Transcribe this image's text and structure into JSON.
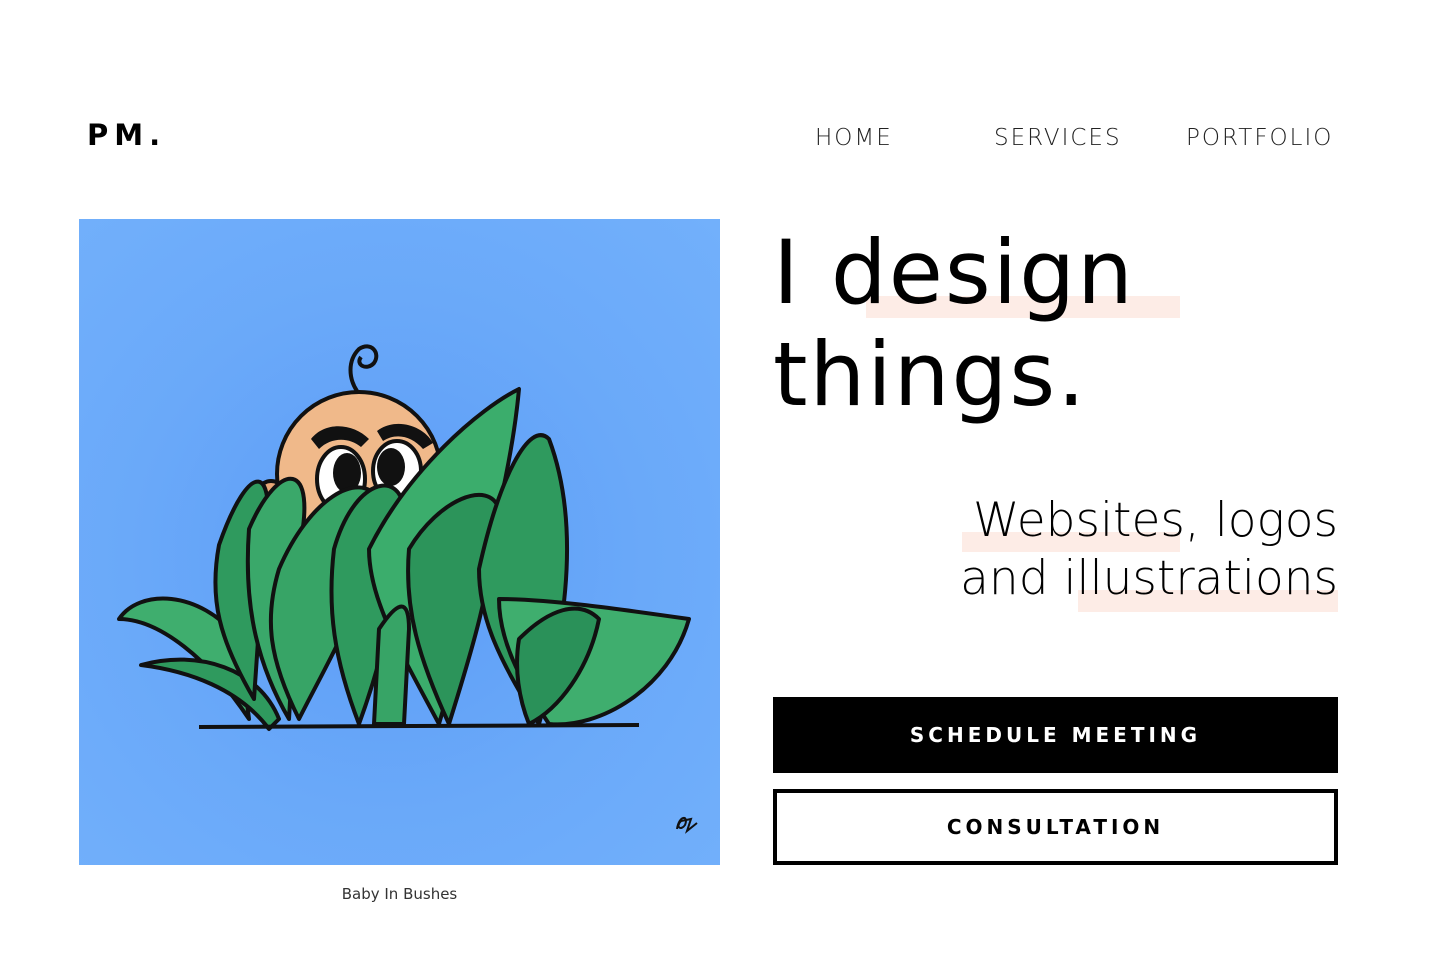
{
  "brand": {
    "logo": "PM."
  },
  "nav": {
    "items": [
      "HOME",
      "SERVICES",
      "PORTFOLIO"
    ]
  },
  "hero": {
    "headline_line1": "I design",
    "headline_line2": "things.",
    "sub_line1": "Websites, logos",
    "sub_line2": "and illustrations",
    "highlight_color": "#fdece6"
  },
  "artwork": {
    "caption": "Baby In Bushes",
    "background_color": "#6aa9f9",
    "leaf_color": "#2f9a5e"
  },
  "buttons": {
    "primary_label": "SCHEDULE MEETING",
    "secondary_label": "CONSULTATION"
  }
}
